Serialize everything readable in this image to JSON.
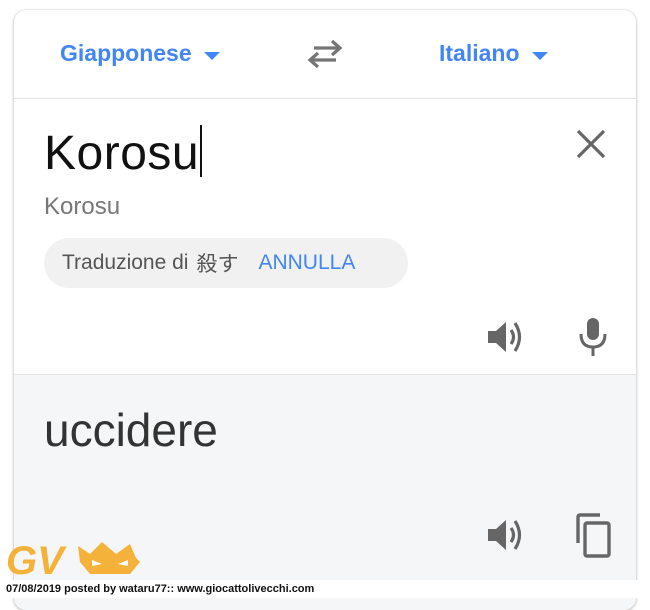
{
  "header": {
    "source_lang": "Giapponese",
    "target_lang": "Italiano"
  },
  "input": {
    "text": "Korosu",
    "transliteration": "Korosu",
    "suggestion_label": "Traduzione di",
    "suggestion_word": "殺す",
    "undo_label": "ANNULLA"
  },
  "output": {
    "text": "uccidere"
  },
  "watermark": {
    "logo_text": "GV",
    "footer": "07/08/2019 posted by wataru77:: www.giocattolivecchi.com"
  },
  "icons": [
    "chevron-down-icon",
    "swap-icon",
    "close-icon",
    "speaker-icon",
    "microphone-icon",
    "copy-icon"
  ],
  "colors": {
    "accent": "#4285f4",
    "output_bg": "#f5f6f7",
    "chip_bg": "#f1f1f1",
    "logo": "#f5b23a"
  }
}
